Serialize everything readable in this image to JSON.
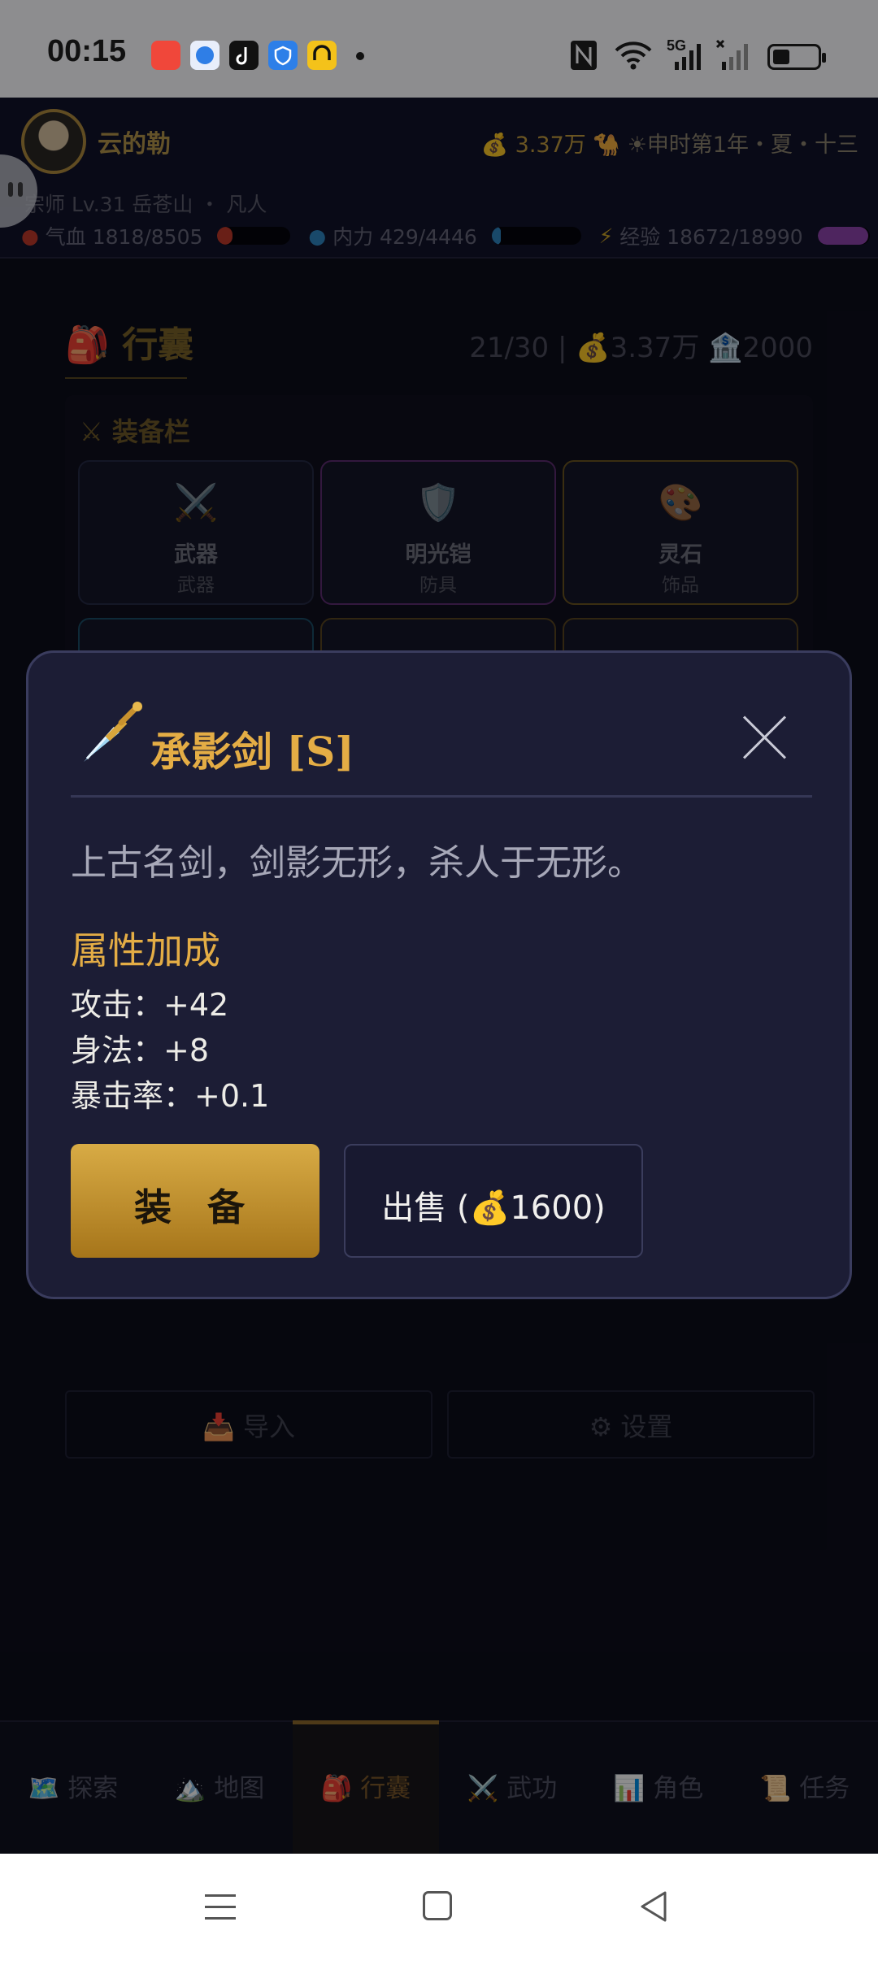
{
  "status_bar": {
    "time": "00:15",
    "network": "5G",
    "apps": [
      "kuaishou-icon",
      "browser-icon",
      "tiktok-icon",
      "shield-app-icon",
      "game-app-icon"
    ]
  },
  "player": {
    "name": "云的勒",
    "money": "3.37万",
    "time_label": "申时第1年・夏・十三",
    "title_line": "宗师 Lv.31 岳苍山 ・ 凡人",
    "hp_label": "气血 1818/8505",
    "hp_fraction": 0.21,
    "mp_label": "内力 429/4446",
    "mp_fraction": 0.1,
    "exp_label": "经验 18672/18990",
    "exp_fraction": 0.98,
    "colors": {
      "hp": "#c0392b",
      "mp": "#2e86c1",
      "exp": "#8e44ad"
    }
  },
  "inventory": {
    "title": "行囊",
    "capacity": "21/30",
    "money": "3.37万",
    "bank": "2000",
    "equip_title": "装备栏",
    "slots": [
      {
        "name": "武器",
        "type": "武器",
        "icon": "crossed-swords-icon"
      },
      {
        "name": "明光铠",
        "type": "防具",
        "icon": "shield-icon"
      },
      {
        "name": "灵石",
        "type": "饰品",
        "icon": "gem-icon"
      }
    ],
    "import_label": "导入",
    "settings_label": "设置"
  },
  "nav": {
    "items": [
      {
        "label": "探索",
        "icon": "map-icon"
      },
      {
        "label": "地图",
        "icon": "mountain-icon"
      },
      {
        "label": "行囊",
        "icon": "backpack-icon"
      },
      {
        "label": "武功",
        "icon": "swords-icon"
      },
      {
        "label": "角色",
        "icon": "chart-icon"
      },
      {
        "label": "任务",
        "icon": "scroll-icon"
      }
    ],
    "active": "行囊"
  },
  "modal": {
    "title": "承影剑 [S]",
    "icon": "dagger-icon",
    "description": "上古名剑，剑影无形，杀人于无形。",
    "section_title": "属性加成",
    "stats": [
      "攻击：+42",
      "身法：+8",
      "暴击率：+0.1"
    ],
    "equip_label": "装 备",
    "sell_label": "出售 (",
    "sell_price": "1600",
    "sell_suffix": ")",
    "accent_color": "#e4ad45"
  }
}
